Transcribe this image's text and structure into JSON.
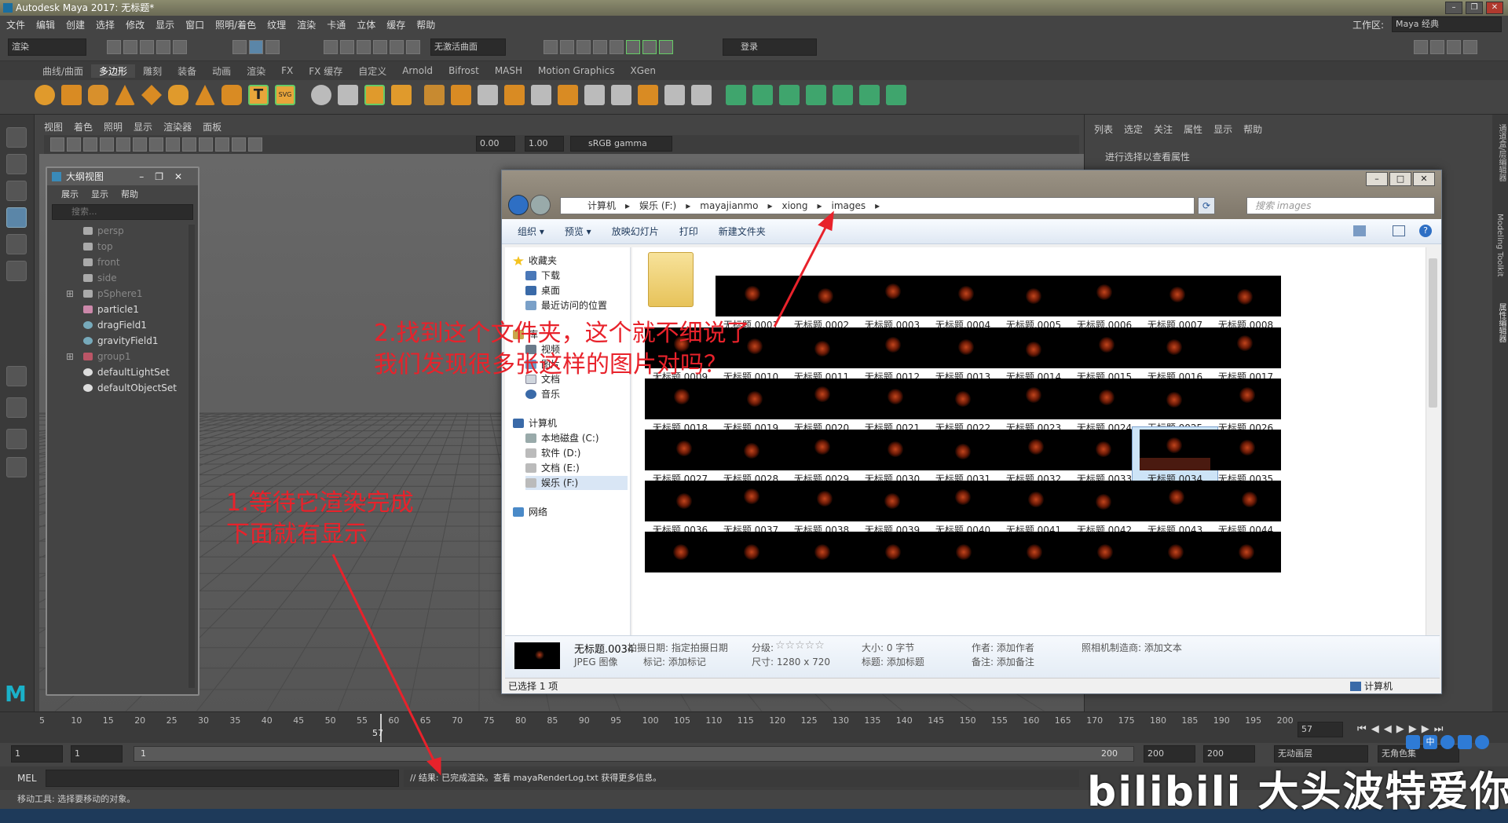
{
  "window_title": "Autodesk Maya 2017: 无标题*",
  "menubar": [
    "文件",
    "编辑",
    "创建",
    "选择",
    "修改",
    "显示",
    "窗口",
    "照明/着色",
    "纹理",
    "渲染",
    "卡通",
    "立体",
    "缓存",
    "帮助"
  ],
  "workspace_label": "工作区:",
  "workspace_value": "Maya 经典",
  "mode_combo": "渲染",
  "no_live_surface": "无激活曲面",
  "login": "登录",
  "shelf_tabs": [
    "曲线/曲面",
    "多边形",
    "雕刻",
    "装备",
    "动画",
    "渲染",
    "FX",
    "FX 缓存",
    "自定义",
    "Arnold",
    "Bifrost",
    "MASH",
    "Motion Graphics",
    "XGen"
  ],
  "shelf_active": "多边形",
  "panel_menu": [
    "视图",
    "着色",
    "照明",
    "显示",
    "渲染器",
    "面板"
  ],
  "panel_gamma_a": "0.00",
  "panel_gamma_b": "1.00",
  "panel_colorspace": "sRGB gamma",
  "attr_menu": [
    "列表",
    "选定",
    "关注",
    "属性",
    "显示",
    "帮助"
  ],
  "attr_hint": "进行选择以查看属性",
  "side_tabs": [
    "通道盒/层编辑器",
    "Modeling Toolkit",
    "属性编辑器"
  ],
  "outliner": {
    "title": "大纲视图",
    "menu": [
      "展示",
      "显示",
      "帮助"
    ],
    "search_placeholder": "搜索...",
    "items": [
      {
        "label": "persp",
        "dim": true
      },
      {
        "label": "top",
        "dim": true
      },
      {
        "label": "front",
        "dim": true
      },
      {
        "label": "side",
        "dim": true
      },
      {
        "label": "pSphere1",
        "dim": true
      },
      {
        "label": "particle1",
        "dim": false
      },
      {
        "label": "dragField1",
        "dim": false
      },
      {
        "label": "gravityField1",
        "dim": false
      },
      {
        "label": "group1",
        "dim": true
      },
      {
        "label": "defaultLightSet",
        "dim": false
      },
      {
        "label": "defaultObjectSet",
        "dim": false
      }
    ]
  },
  "timeline_ticks": [
    "5",
    "10",
    "15",
    "20",
    "25",
    "30",
    "35",
    "40",
    "45",
    "50",
    "55",
    "60",
    "65",
    "70",
    "75",
    "80",
    "85",
    "90",
    "95",
    "100",
    "105",
    "110",
    "115",
    "120",
    "125",
    "130",
    "135",
    "140",
    "145",
    "150",
    "155",
    "160",
    "165",
    "170",
    "175",
    "180",
    "185",
    "190",
    "195",
    "200"
  ],
  "current_frame": "57",
  "current_frame_field": "57",
  "range": {
    "start": "1",
    "start2": "1",
    "slider_label": "1",
    "end_a": "200",
    "end_b": "200",
    "end_c": "200",
    "anim_layer": "无动画层",
    "char_set": "无角色集"
  },
  "mel_label": "MEL",
  "mel_result": "// 结果: 已完成渲染。查看 mayaRenderLog.txt 获得更多信息。",
  "status_text": "移动工具: 选择要移动的对象。",
  "explorer": {
    "breadcrumb": [
      "计算机",
      "娱乐 (F:)",
      "mayajianmo",
      "xiong",
      "images"
    ],
    "search_placeholder": "搜索 images",
    "commands": [
      "组织 ▾",
      "预览 ▾",
      "放映幻灯片",
      "打印",
      "新建文件夹"
    ],
    "nav": {
      "favorites": "收藏夹",
      "fav_items": [
        "下载",
        "桌面",
        "最近访问的位置"
      ],
      "libs_partial": "库",
      "libs_items_partial": "视频",
      "lib_items": [
        "图片",
        "文档",
        "音乐"
      ],
      "computer": "计算机",
      "drives": [
        "本地磁盘 (C:)",
        "软件 (D:)",
        "文档 (E:)",
        "娱乐 (F:)"
      ],
      "network": "网络"
    },
    "files_row1": [
      "无标题.0001",
      "无标题.0002",
      "无标题.0003",
      "无标题.0004",
      "无标题.0005",
      "无标题.0006",
      "无标题.0007",
      "无标题.0008"
    ],
    "files_row2": [
      "无标题.0009",
      "无标题.0010",
      "无标题.0011",
      "无标题.0012",
      "无标题.0013",
      "无标题.0014",
      "无标题.0015",
      "无标题.0016",
      "无标题.0017"
    ],
    "files_row3": [
      "无标题.0018",
      "无标题.0019",
      "无标题.0020",
      "无标题.0021",
      "无标题.0022",
      "无标题.0023",
      "无标题.0024",
      "无标题.0025",
      "无标题.0026"
    ],
    "files_row4": [
      "无标题.0027",
      "无标题.0028",
      "无标题.0029",
      "无标题.0030",
      "无标题.0031",
      "无标题.0032",
      "无标题.0033",
      "无标题.0034",
      "无标题.0035"
    ],
    "files_row5": [
      "无标题.0036",
      "无标题.0037",
      "无标题.0038",
      "无标题.0039",
      "无标题.0040",
      "无标题.0041",
      "无标题.0042",
      "无标题.0043",
      "无标题.0044"
    ],
    "selected_file": "无标题.0034",
    "details": {
      "name": "无标题.0034",
      "type": "JPEG 图像",
      "shot_date": "拍摄日期: 指定拍摄日期",
      "tags": "标记: 添加标记",
      "rating": "分级:",
      "stars": "☆☆☆☆☆",
      "dimensions": "尺寸: 1280 x 720",
      "size": "大小: 0 字节",
      "title": "标题: 添加标题",
      "author": "作者: 添加作者",
      "comments": "备注: 添加备注",
      "camera_maker": "照相机制造商: 添加文本"
    },
    "status_selected": "已选择 1 项",
    "status_location": "计算机"
  },
  "annotations": {
    "note2_line1": "2.找到这个文件夹，这个就不细说了",
    "note2_line2": "我们发现很多张这样的图片对吗？",
    "note1_line1": "1.等待它渲染完成",
    "note1_line2": "下面就有显示"
  },
  "watermark": "bilibili 大头波特爱你",
  "colors": {
    "annotation": "#e8222b",
    "maya_bg": "#444444",
    "explorer_bg": "#f0f0f0"
  }
}
